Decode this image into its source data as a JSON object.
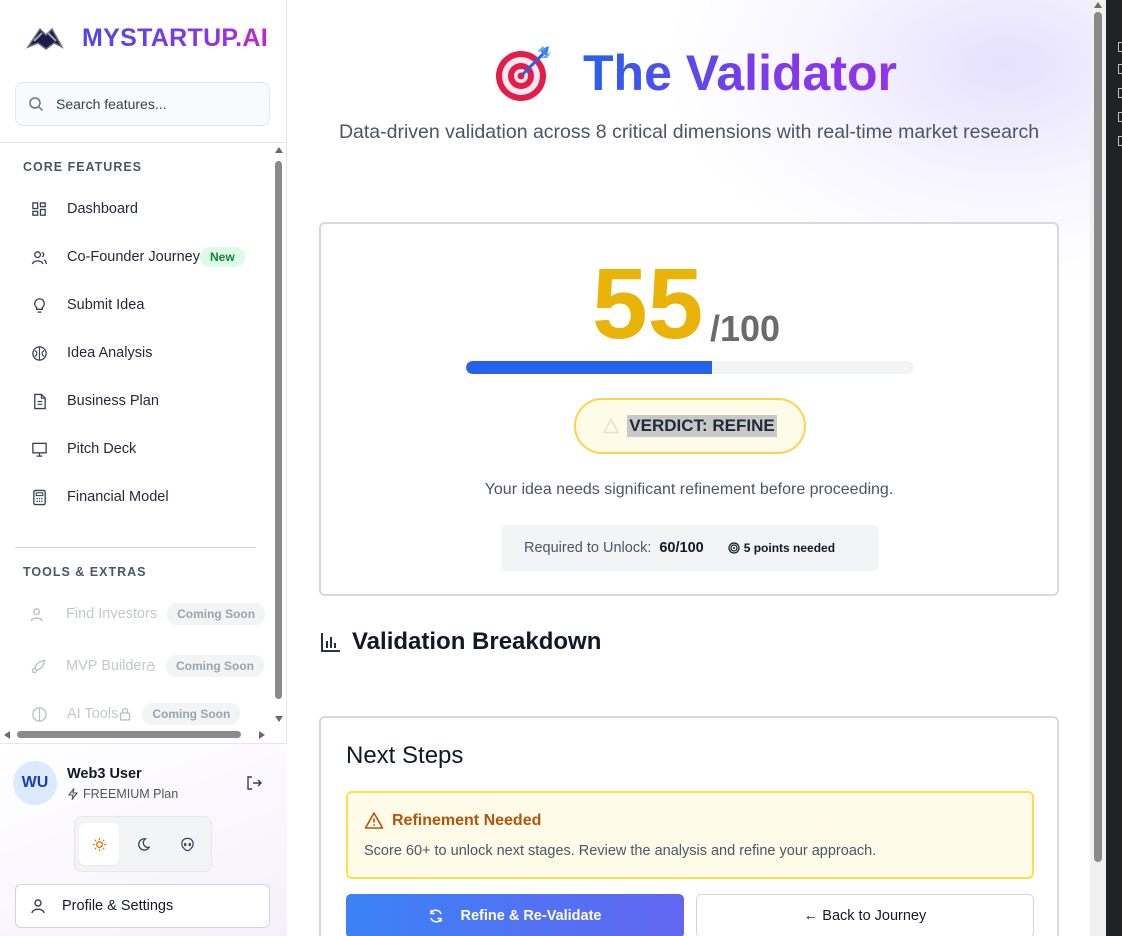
{
  "app": {
    "brand": "MYSTARTUP.AI"
  },
  "search": {
    "placeholder": "Search features..."
  },
  "sidebar": {
    "core_title": "CORE FEATURES",
    "core_items": [
      {
        "label": "Dashboard",
        "icon": "grid-icon"
      },
      {
        "label": "Co-Founder Journey",
        "icon": "users-icon",
        "badge": "New"
      },
      {
        "label": "Submit Idea",
        "icon": "lightbulb-icon"
      },
      {
        "label": "Idea Analysis",
        "icon": "brain-icon"
      },
      {
        "label": "Business Plan",
        "icon": "document-icon"
      },
      {
        "label": "Pitch Deck",
        "icon": "presentation-icon"
      },
      {
        "label": "Financial Model",
        "icon": "calculator-icon"
      }
    ],
    "tools_title": "TOOLS & EXTRAS",
    "tools_items": [
      {
        "label": "Find Investors",
        "icon": "users-icon",
        "badge": "Coming Soon"
      },
      {
        "label": "MVP Builder",
        "icon": "rocket-icon",
        "badge": "Coming Soon"
      },
      {
        "label": "AI Tools",
        "icon": "brain-icon",
        "badge": "Coming Soon"
      }
    ]
  },
  "user": {
    "initials": "WU",
    "name": "Web3 User",
    "plan": "FREEMIUM Plan"
  },
  "profile_button": "Profile & Settings",
  "main": {
    "title": "The Validator",
    "subtitle": "Data-driven validation across 8 critical dimensions with real-time market research",
    "score": {
      "value": "55",
      "max": "/100",
      "fraction": 0.55
    },
    "verdict": "VERDICT: REFINE",
    "verdict_desc": "Your idea needs significant refinement before proceeding.",
    "unlock": {
      "label": "Required to Unlock:",
      "value": "60/100",
      "points": "5 points needed"
    },
    "breakdown_title": "Validation Breakdown",
    "next_steps": {
      "title": "Next Steps",
      "alert_title": "Refinement Needed",
      "alert_text": "Score 60+ to unlock next stages. Review the analysis and refine your approach.",
      "primary_button": "Refine & Re-Validate",
      "secondary_button": "← Back to Journey"
    }
  },
  "colors": {
    "accent": "#2563eb",
    "score": "#eab308",
    "warning": "#b45309"
  }
}
